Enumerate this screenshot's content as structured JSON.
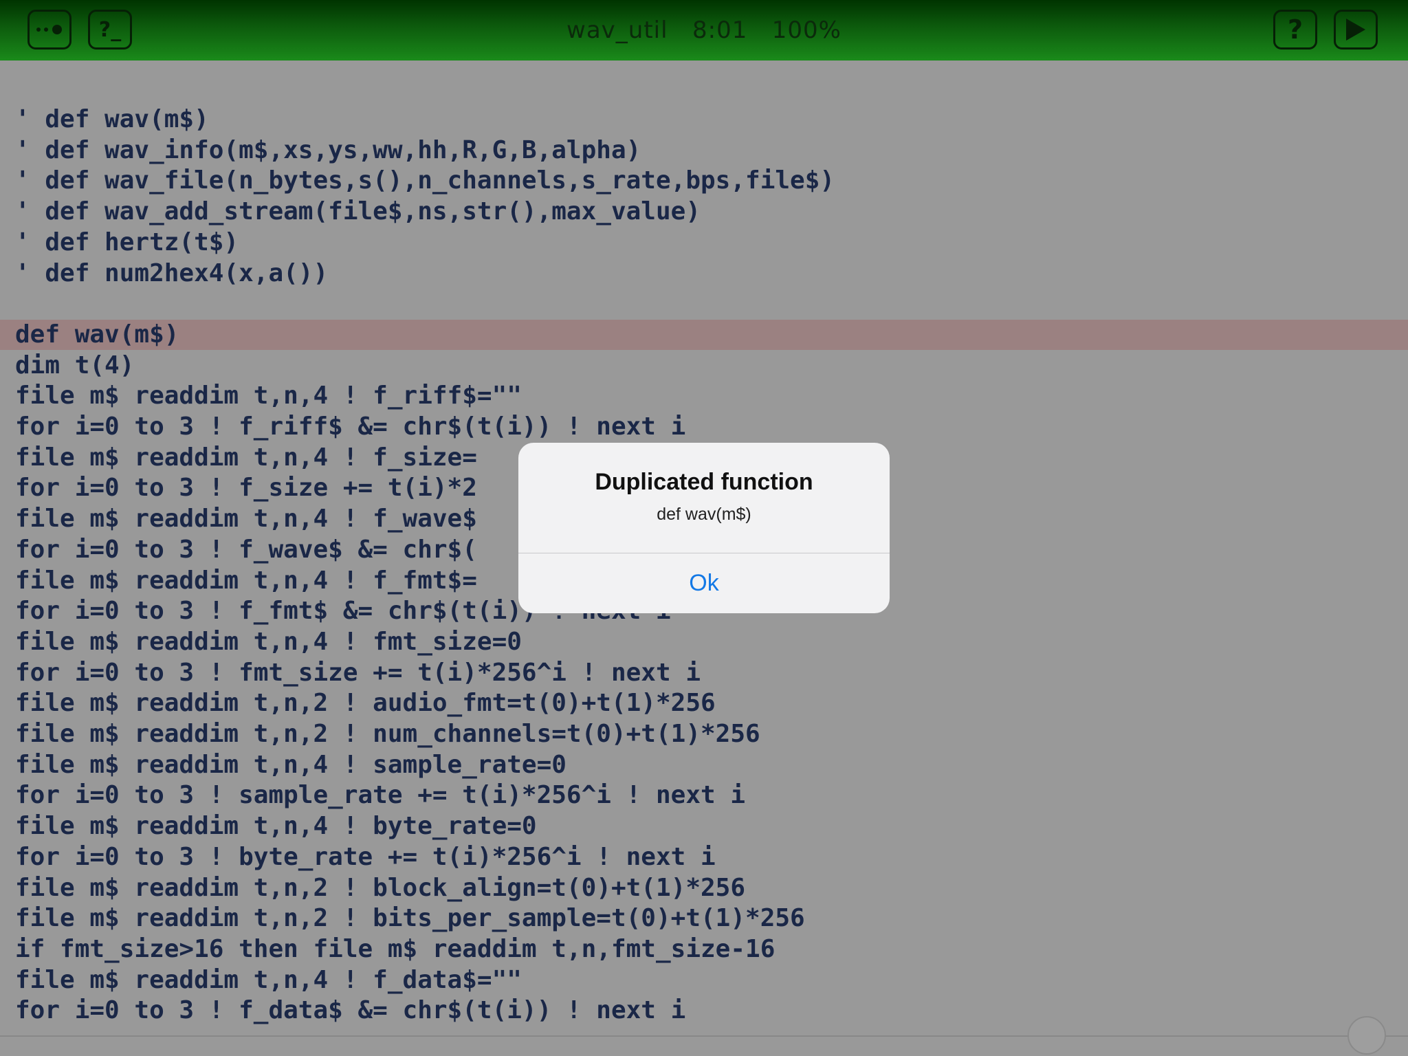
{
  "topbar": {
    "title": "wav_util   8:01   100%",
    "menu_icon": "more-dots-icon",
    "console_label": "?_",
    "help_label": "?",
    "run_icon": "play-icon"
  },
  "code_lines": [
    "' def wav(m$)",
    "' def wav_info(m$,xs,ys,ww,hh,R,G,B,alpha)",
    "' def wav_file(n_bytes,s(),n_channels,s_rate,bps,file$)",
    "' def wav_add_stream(file$,ns,str(),max_value)",
    "' def hertz(t$)",
    "' def num2hex4(x,a())",
    "",
    "def wav(m$)",
    "dim t(4)",
    "file m$ readdim t,n,4 ! f_riff$=\"\"",
    "for i=0 to 3 ! f_riff$ &= chr$(t(i)) ! next i",
    "file m$ readdim t,n,4 ! f_size=",
    "for i=0 to 3 ! f_size += t(i)*2",
    "file m$ readdim t,n,4 ! f_wave$",
    "for i=0 to 3 ! f_wave$ &= chr$(",
    "file m$ readdim t,n,4 ! f_fmt$=",
    "for i=0 to 3 ! f_fmt$ &= chr$(t(i)) ! next i",
    "file m$ readdim t,n,4 ! fmt_size=0",
    "for i=0 to 3 ! fmt_size += t(i)*256^i ! next i",
    "file m$ readdim t,n,2 ! audio_fmt=t(0)+t(1)*256",
    "file m$ readdim t,n,2 ! num_channels=t(0)+t(1)*256",
    "file m$ readdim t,n,4 ! sample_rate=0",
    "for i=0 to 3 ! sample_rate += t(i)*256^i ! next i",
    "file m$ readdim t,n,4 ! byte_rate=0",
    "for i=0 to 3 ! byte_rate += t(i)*256^i ! next i",
    "file m$ readdim t,n,2 ! block_align=t(0)+t(1)*256",
    "file m$ readdim t,n,2 ! bits_per_sample=t(0)+t(1)*256",
    "if fmt_size>16 then file m$ readdim t,n,fmt_size-16",
    "file m$ readdim t,n,4 ! f_data$=\"\"",
    "for i=0 to 3 ! f_data$ &= chr$(t(i)) ! next i"
  ],
  "highlighted_line": 7,
  "alert": {
    "title": "Duplicated function",
    "message": "def wav(m$)",
    "ok_label": "Ok"
  },
  "colors": {
    "accent_green": "#1a8a1a",
    "code_text": "#1a2747",
    "highlight_row": "#9b8181",
    "ok_blue": "#1479e6"
  }
}
